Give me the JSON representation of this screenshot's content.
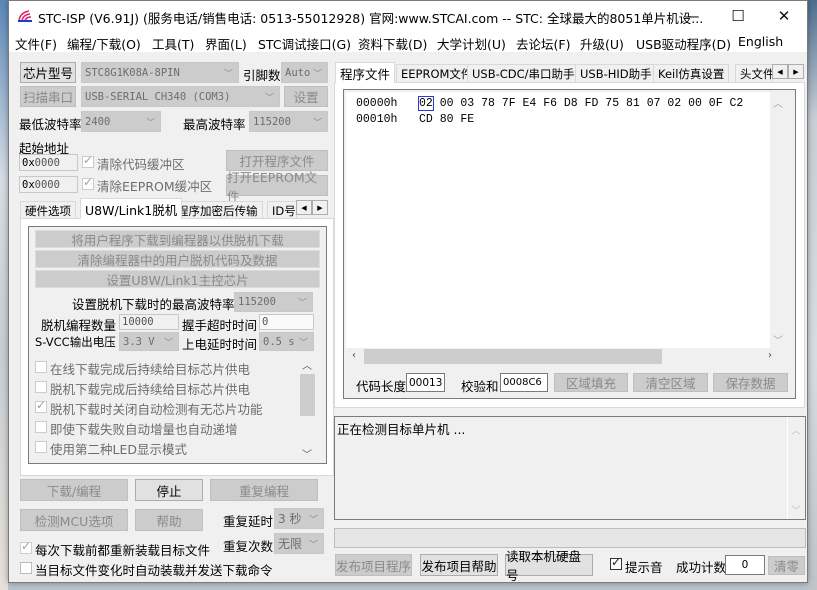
{
  "window": {
    "title": "STC-ISP (V6.91J) (服务电话/销售电话: 0513-55012928) 官网:www.STCAI.com  -- STC: 全球最大的8051单片机设...",
    "minimize": "—",
    "maximize": "☐",
    "close": "✕"
  },
  "menu": [
    "文件(F)",
    "编程/下载(O)",
    "工具(T)",
    "界面(L)",
    "STC调试接口(G)",
    "资料下载(D)",
    "大学计划(U)",
    "去论坛(F)",
    "升级(U)",
    "USB驱动程序(D)",
    "English"
  ],
  "left": {
    "chip_type_button": "芯片型号",
    "chip_type_value": "STC8G1K08A-8PIN",
    "pin_count_label": "引脚数",
    "pin_count_value": "Auto",
    "scan_port_button": "扫描串口",
    "port_value": "USB-SERIAL CH340 (COM3)",
    "settings_button": "设置",
    "min_baud_label": "最低波特率",
    "min_baud_value": "2400",
    "max_baud_label": "最高波特率",
    "max_baud_value": "115200",
    "start_addr_label": "起始地址",
    "code_addr_prefix": "0x",
    "code_addr_value": "0000",
    "clear_code_buffer": "清除代码缓冲区",
    "open_program_file": "打开程序文件",
    "eeprom_addr_prefix": "0x",
    "eeprom_addr_value": "0000",
    "clear_eeprom_buffer": "清除EEPROM缓冲区",
    "open_eeprom_file": "打开EEPROM文件",
    "tabs": [
      "硬件选项",
      "U8W/Link1脱机",
      "程序加密后传输",
      "ID号"
    ],
    "offline": {
      "download_to_programmer": "将用户程序下载到编程器以供脱机下载",
      "clear_offline_code": "清除编程器中的用户脱机代码及数据",
      "set_master_chip": "设置U8W/Link1主控芯片",
      "max_baud_label": "设置脱机下载时的最高波特率",
      "max_baud_value": "115200",
      "prog_count_label": "脱机编程数量",
      "prog_count_value": "10000",
      "handshake_label": "握手超时时间",
      "handshake_value": "0",
      "svcc_label": "S-VCC输出电压",
      "svcc_value": "3.3 V",
      "power_delay_label": "上电延时时间",
      "power_delay_value": "0.5 s",
      "options": [
        {
          "label": "在线下载完成后持续给目标芯片供电",
          "checked": false
        },
        {
          "label": "脱机下载完成后持续给目标芯片供电",
          "checked": false
        },
        {
          "label": "脱机下载时关闭自动检测有无芯片功能",
          "checked": true
        },
        {
          "label": "即使下载失败自动增量也自动递增",
          "checked": false
        },
        {
          "label": "使用第二种LED显示模式",
          "checked": false
        }
      ]
    },
    "download_button": "下载/编程",
    "stop_button": "停止",
    "repeat_program_button": "重复编程",
    "check_mcu_button": "检测MCU选项",
    "help_button": "帮助",
    "repeat_delay_label": "重复延时",
    "repeat_delay_value": "3 秒",
    "repeat_count_label": "重复次数",
    "repeat_count_value": "无限",
    "reload_before_download": {
      "label": "每次下载前都重新装载目标文件",
      "checked": true
    },
    "auto_load_on_change": {
      "label": "当目标文件变化时自动装载并发送下载命令",
      "checked": false
    }
  },
  "right": {
    "tabs": [
      "程序文件",
      "EEPROM文件",
      "USB-CDC/串口助手",
      "USB-HID助手",
      "Keil仿真设置",
      "头文件"
    ],
    "hex_rows": [
      {
        "addr": "00000h",
        "bytes": [
          "02",
          "00",
          "03",
          "78",
          "7F",
          "E4",
          "F6",
          "D8",
          "FD",
          "75",
          "81",
          "07",
          "02",
          "00",
          "0F",
          "C2"
        ]
      },
      {
        "addr": "00010h",
        "bytes": [
          "CD",
          "80",
          "FE"
        ]
      }
    ],
    "code_length_label": "代码长度",
    "code_length_value": "00013",
    "checksum_label": "校验和",
    "checksum_value": "0008C6",
    "fill_area_button": "区域填充",
    "clear_area_button": "清空区域",
    "save_data_button": "保存数据",
    "log_text": "正在检测目标单片机 ...",
    "publish_program_button": "发布项目程序",
    "publish_help_button": "发布项目帮助",
    "read_disk_button": "读取本机硬盘号",
    "beep": {
      "label": "提示音",
      "checked": true
    },
    "success_count_label": "成功计数",
    "success_count_value": "0",
    "clear_count_button": "清零"
  }
}
